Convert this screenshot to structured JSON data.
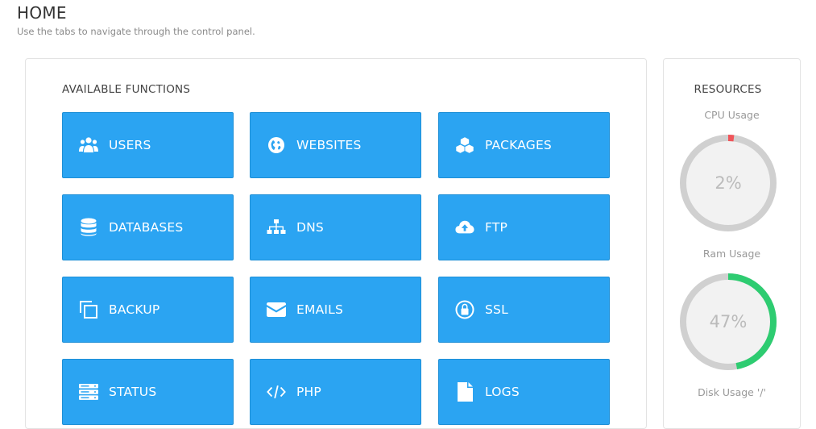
{
  "header": {
    "title": "HOME",
    "subtitle": "Use the tabs to navigate through the control panel."
  },
  "functions": {
    "title": "AVAILABLE FUNCTIONS",
    "tiles": [
      {
        "label": "USERS",
        "icon": "users-icon"
      },
      {
        "label": "WEBSITES",
        "icon": "globe-icon"
      },
      {
        "label": "PACKAGES",
        "icon": "cubes-icon"
      },
      {
        "label": "DATABASES",
        "icon": "database-icon"
      },
      {
        "label": "DNS",
        "icon": "sitemap-icon"
      },
      {
        "label": "FTP",
        "icon": "cloud-upload-icon"
      },
      {
        "label": "BACKUP",
        "icon": "copy-icon"
      },
      {
        "label": "EMAILS",
        "icon": "envelope-icon"
      },
      {
        "label": "SSL",
        "icon": "lock-icon"
      },
      {
        "label": "STATUS",
        "icon": "server-icon"
      },
      {
        "label": "PHP",
        "icon": "code-icon"
      },
      {
        "label": "LOGS",
        "icon": "file-icon"
      }
    ]
  },
  "resources": {
    "title": "RESOURCES",
    "cpu": {
      "label": "CPU Usage",
      "value_text": "2%",
      "percent": 2,
      "color": "#f0555a"
    },
    "ram": {
      "label": "Ram Usage",
      "value_text": "47%",
      "percent": 47,
      "color": "#2ecc71"
    },
    "disk": {
      "label": "Disk Usage '/'"
    }
  },
  "colors": {
    "tile_bg": "#2ba4f2",
    "gauge_track": "#d0d0d0",
    "gauge_inner": "#f2f2f2"
  }
}
